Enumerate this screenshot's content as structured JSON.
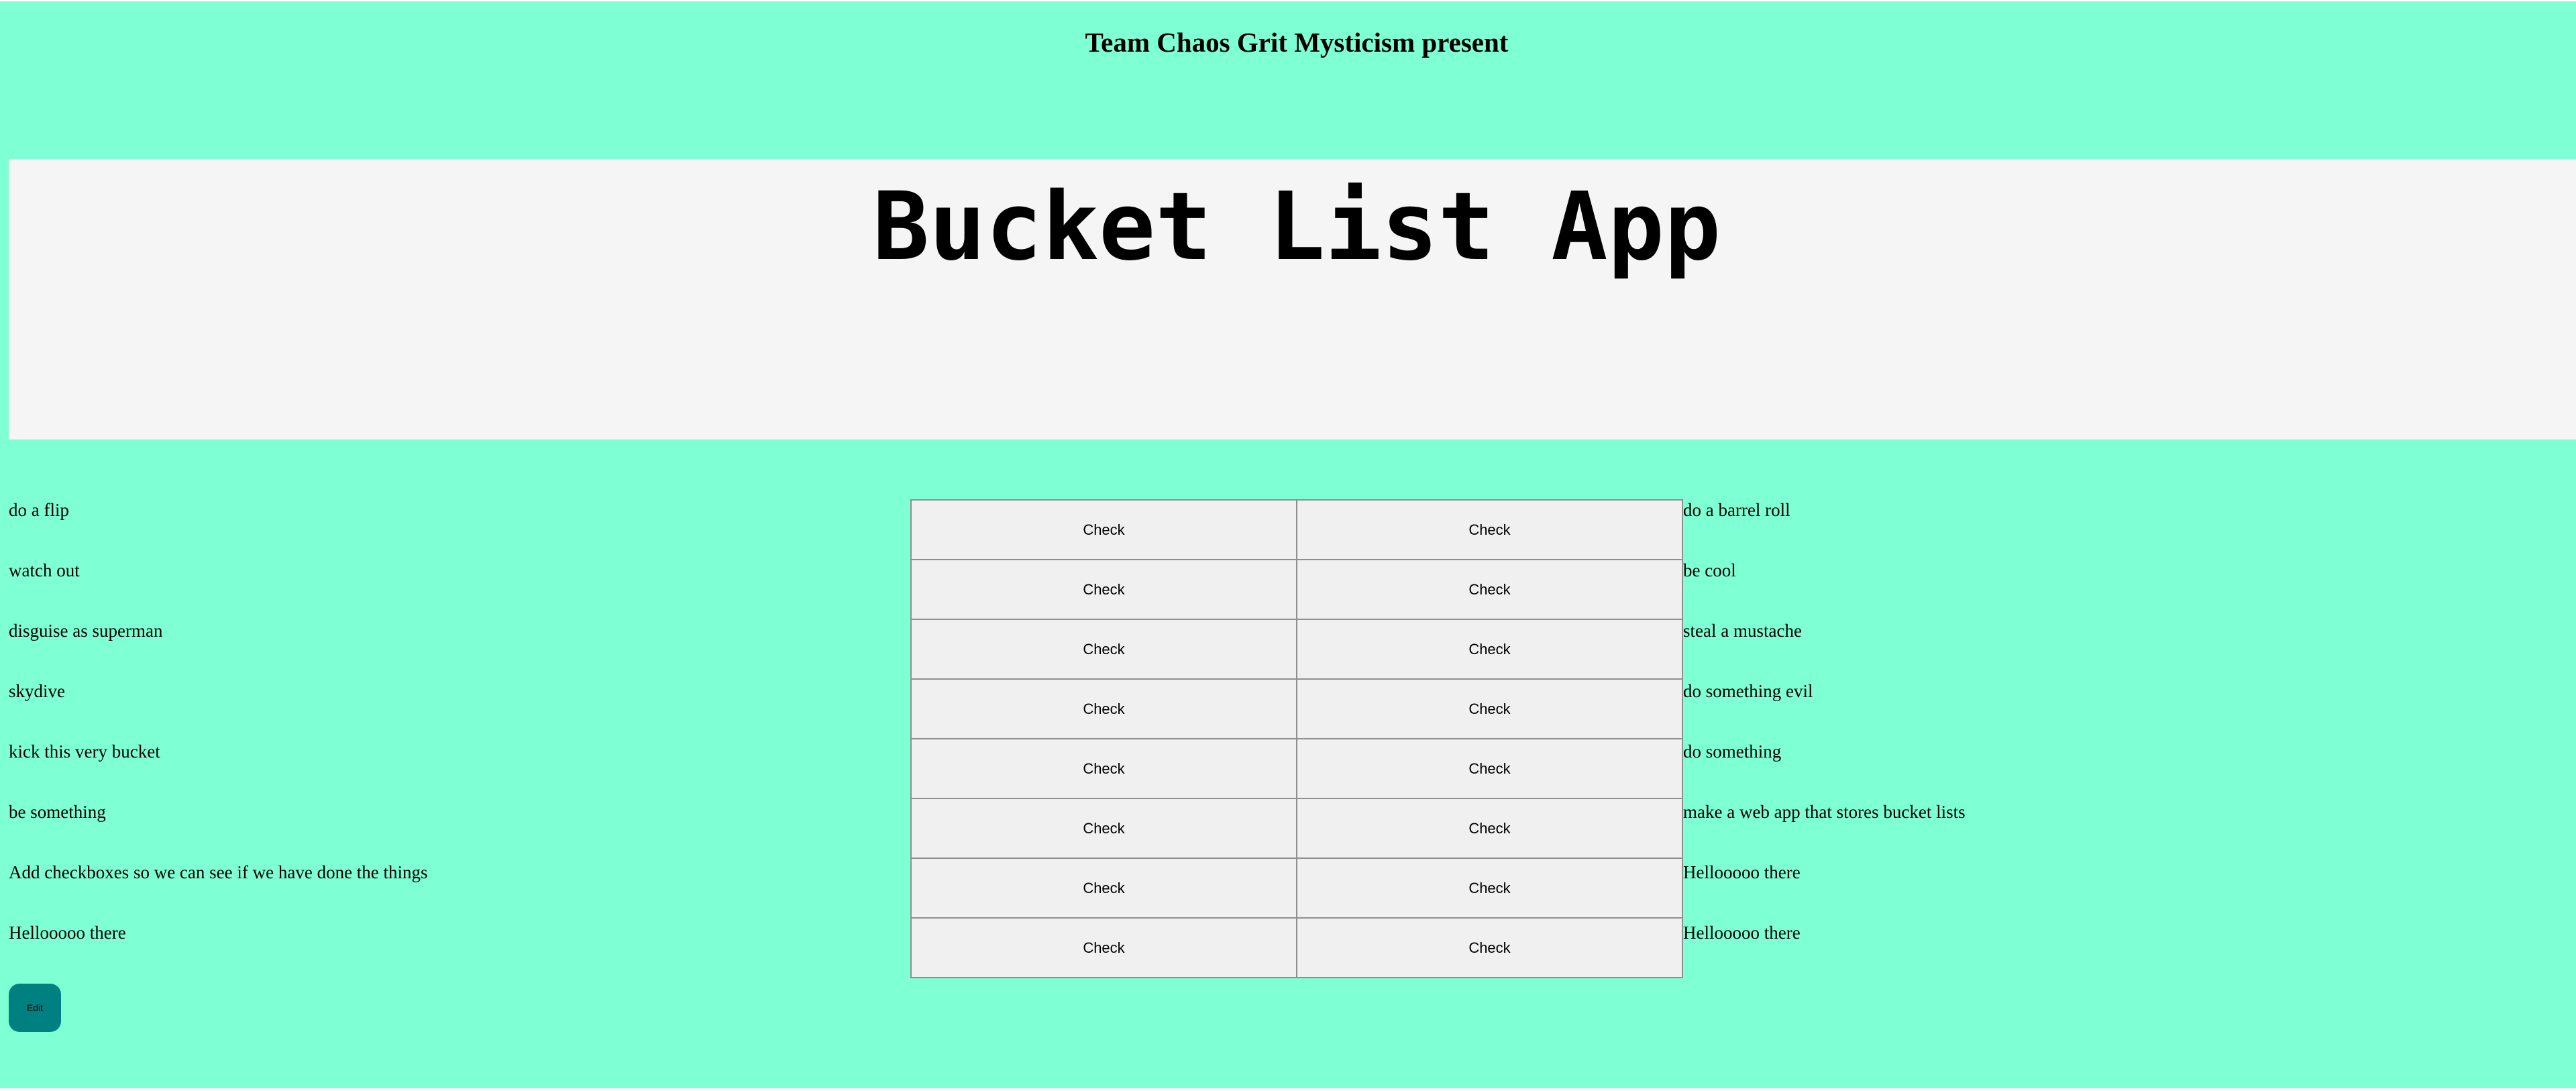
{
  "header": {
    "presenter": "Team Chaos Grit Mysticism present",
    "app_title": "Bucket List App"
  },
  "left_items": [
    "do a flip",
    "watch out",
    "disguise as superman",
    "skydive",
    "kick this very bucket",
    "be something",
    "Add checkboxes so we can see if we have done the things",
    "Hellooooo there"
  ],
  "right_items": [
    "do a barrel roll",
    "be cool",
    "steal a mustache",
    "do something evil",
    "do something",
    "make a web app that stores bucket lists",
    "Hellooooo there",
    "Hellooooo there"
  ],
  "check_label": "Check",
  "edit_label": "Edit",
  "colors": {
    "background": "#7fffd4",
    "banner": "#f5f5f5",
    "check_button": "#f0f0f0",
    "edit_button": "#008080"
  }
}
